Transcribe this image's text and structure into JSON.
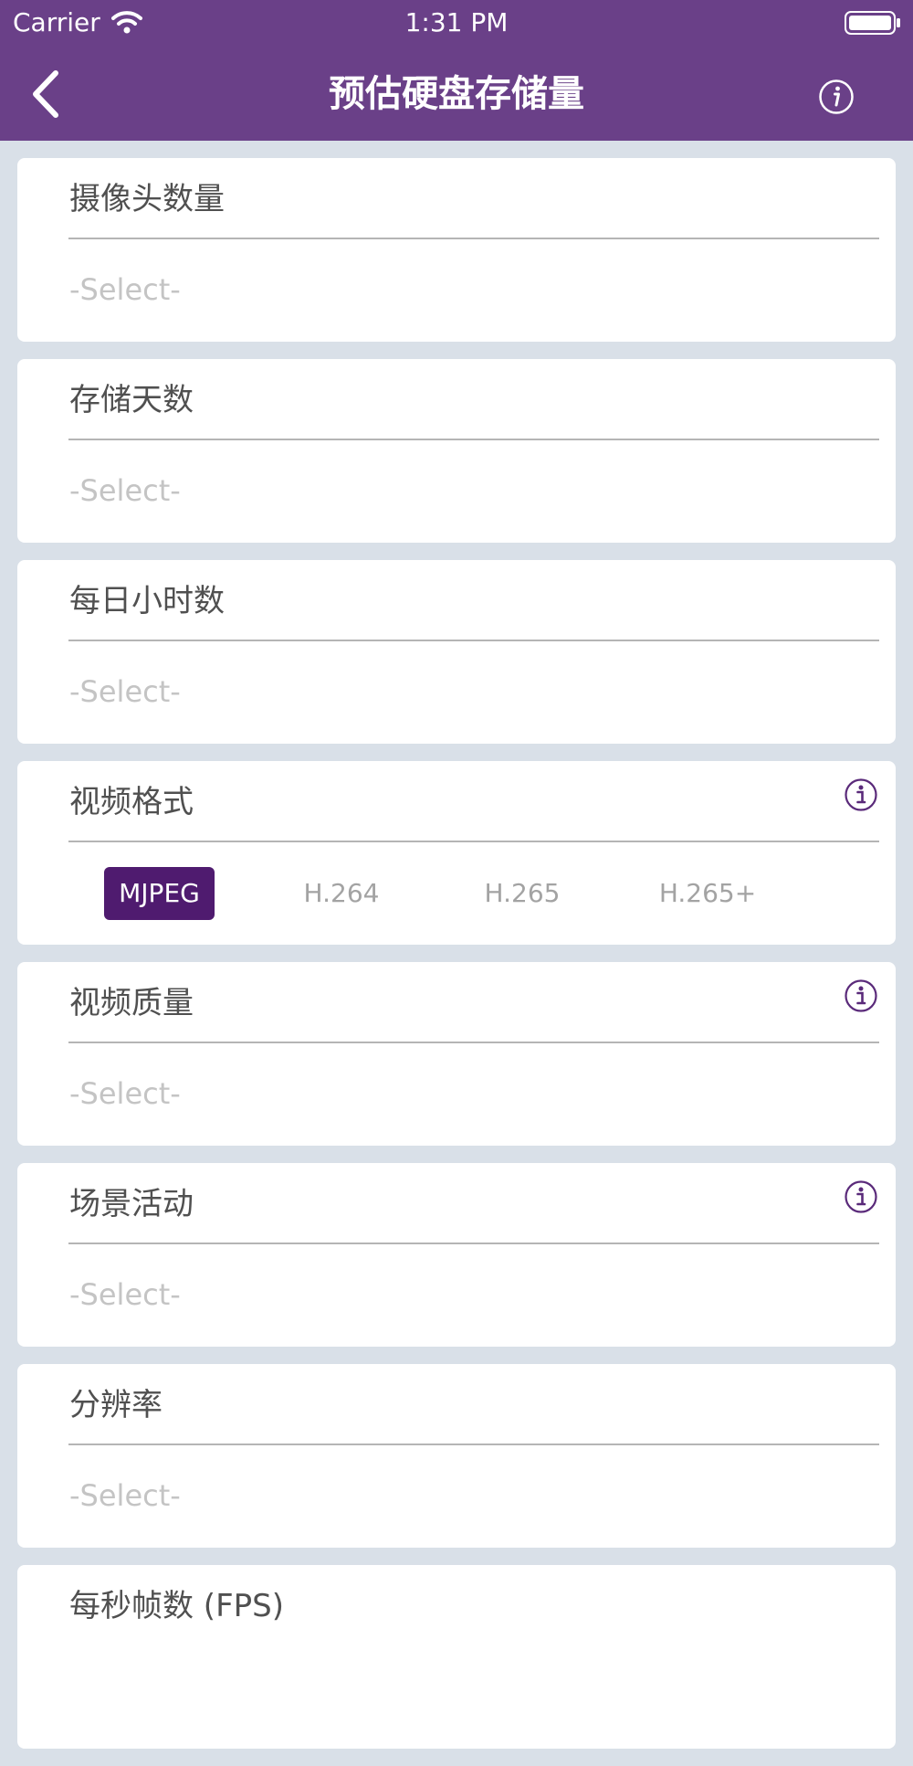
{
  "status_bar": {
    "carrier": "Carrier",
    "time": "1:31 PM"
  },
  "nav": {
    "title": "预估硬盘存储量",
    "back_icon": "chevron-left-icon",
    "info_icon": "info-icon"
  },
  "colors": {
    "accent": "#6a4088",
    "selected": "#4f1b6f",
    "background": "#d9e0e8"
  },
  "fields": [
    {
      "label": "摄像头数量",
      "value": "-Select-"
    },
    {
      "label": "存储天数",
      "value": "-Select-"
    },
    {
      "label": "每日小时数",
      "value": "-Select-"
    },
    {
      "label": "视频格式",
      "options": [
        "MJPEG",
        "H.264",
        "H.265",
        "H.265+"
      ],
      "selected": "MJPEG"
    },
    {
      "label": "视频质量",
      "value": "-Select-"
    },
    {
      "label": "场景活动",
      "value": "-Select-"
    },
    {
      "label": "分辨率",
      "value": "-Select-"
    },
    {
      "label": "每秒帧数 (FPS)"
    }
  ]
}
